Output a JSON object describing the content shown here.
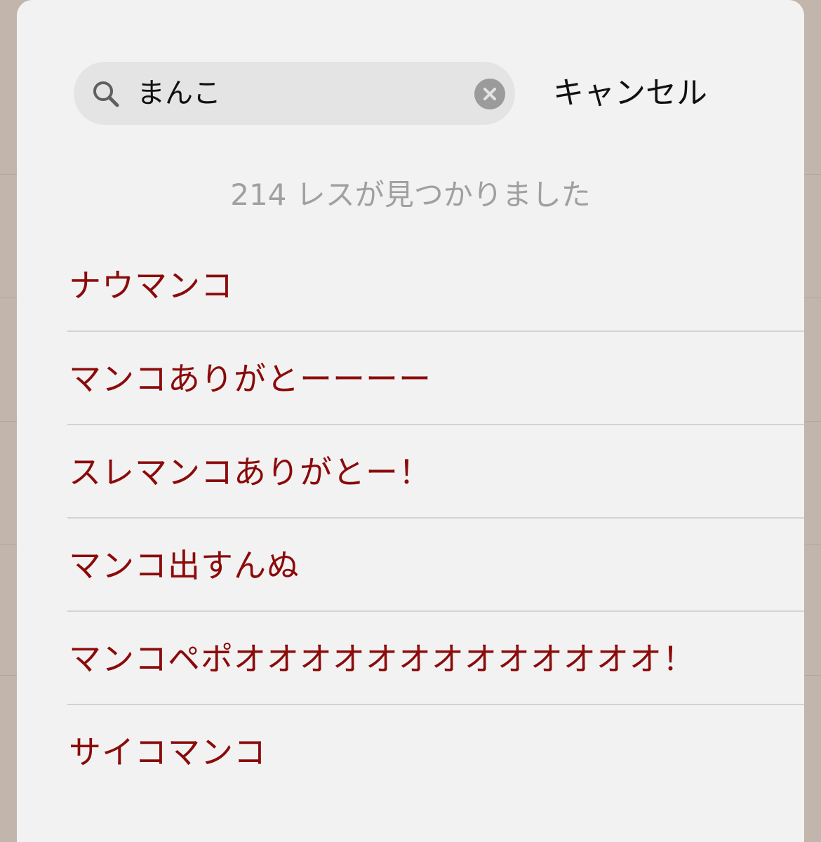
{
  "search": {
    "query": "まんこ",
    "cancel_label": "キャンセル"
  },
  "summary": {
    "result_count_text": "214 レスが見つかりました"
  },
  "results": [
    {
      "text": "ナウマンコ"
    },
    {
      "text": "マンコありがとーーーー"
    },
    {
      "text": "スレマンコありがとー！"
    },
    {
      "text": "マンコ出すんぬ"
    },
    {
      "text": "マンコペポオオオオオオオオオオオオオ！"
    },
    {
      "text": "サイコマンコ"
    }
  ],
  "colors": {
    "result_text": "#8b0a0a",
    "sheet_background": "#f2f2f2",
    "backdrop": "#c2b5ac",
    "search_field": "#e4e4e4",
    "count_text": "#a0a0a0"
  },
  "icons": {
    "search": "magnifier-icon",
    "clear": "clear-circle-x-icon"
  }
}
